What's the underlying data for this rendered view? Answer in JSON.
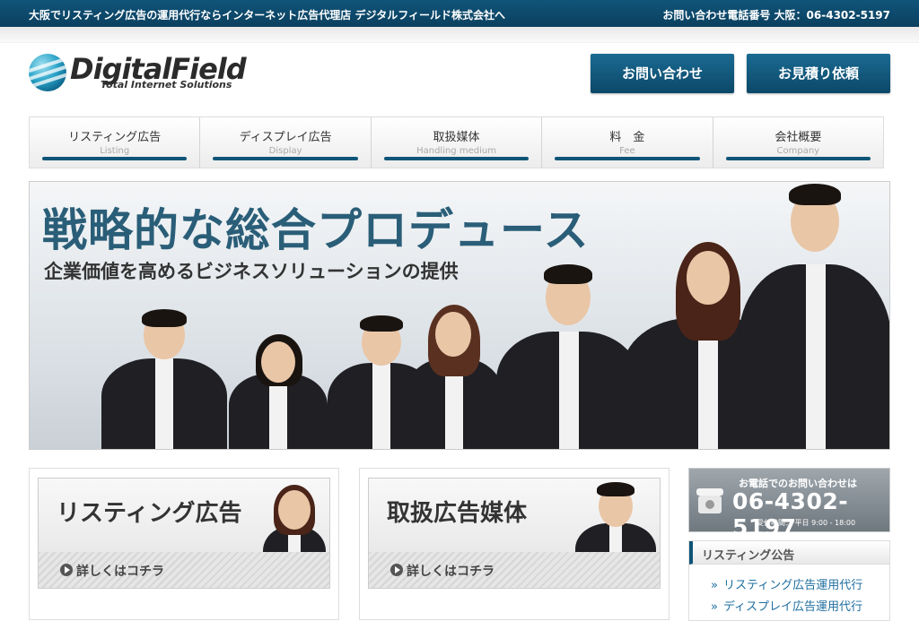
{
  "topbar": {
    "tagline": "大阪でリスティング広告の運用代行ならインターネット広告代理店 デジタルフィールド株式会社へ",
    "phone": "お問い合わせ電話番号 大阪：06-4302-5197"
  },
  "logo": {
    "name": "DigitalField",
    "tagline": "Total Internet Solutions"
  },
  "header_buttons": {
    "contact": "お問い合わせ",
    "estimate": "お見積り依頼"
  },
  "nav": [
    {
      "label": "リスティング広告",
      "sub": "Listing"
    },
    {
      "label": "ディスプレイ広告",
      "sub": "Display"
    },
    {
      "label": "取扱媒体",
      "sub": "Handling medium"
    },
    {
      "label": "料　金",
      "sub": "Fee"
    },
    {
      "label": "会社概要",
      "sub": "Company"
    }
  ],
  "hero": {
    "headline": "戦略的な総合プロデュース",
    "subheadline": "企業価値を高めるビジネスソリューションの提供"
  },
  "cards": [
    {
      "title": "リスティング広告",
      "more": "詳しくはコチラ"
    },
    {
      "title": "取扱広告媒体",
      "more": "詳しくはコチラ"
    }
  ],
  "sidebar": {
    "phone_label": "お電話でのお問い合わせは",
    "phone_number": "06-4302-5197",
    "hours": "受付時間： 平日 9:00 - 18:00",
    "section_title": "リスティング公告",
    "links": [
      "リスティング広告運用代行",
      "ディスプレイ広告運用代行"
    ]
  },
  "colors": {
    "brand": "#0f5577",
    "headline": "#2a5e78",
    "link": "#1f6ea0"
  }
}
